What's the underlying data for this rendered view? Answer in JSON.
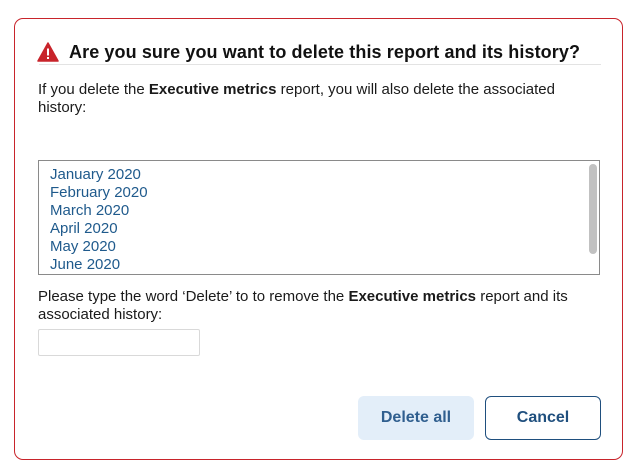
{
  "dialog": {
    "title": "Are you sure you want to delete this report and its history?",
    "intro_prefix": "If you delete the ",
    "report_name": "Executive metrics",
    "intro_suffix": " report, you will also delete the associated history:",
    "history_items": [
      "January 2020",
      "February 2020",
      "March 2020",
      "April 2020",
      "May 2020",
      "June 2020"
    ],
    "prompt_prefix": "Please type the word ‘Delete’ to to remove the ",
    "prompt_suffix": " report and its associated history:",
    "confirm_input": {
      "value": "",
      "placeholder": ""
    },
    "delete_all_label": "Delete all",
    "cancel_label": "Cancel"
  },
  "icons": {
    "warning": "warning-triangle-icon"
  },
  "colors": {
    "danger": "#c8242b",
    "link": "#1f5a8c",
    "primary": "#1f4f7e",
    "primary_light_bg": "#e3eef9"
  }
}
